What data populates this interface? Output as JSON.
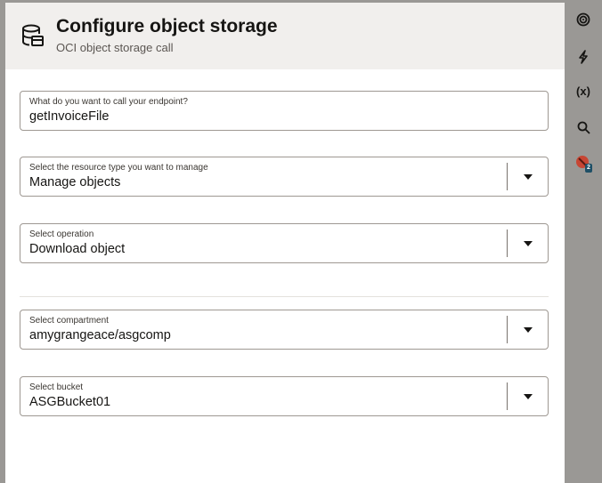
{
  "header": {
    "title": "Configure object storage",
    "subtitle": "OCI object storage call",
    "icon": "database-storage-icon"
  },
  "form": {
    "endpoint": {
      "label": "What do you want to call your endpoint?",
      "value": "getInvoiceFile"
    },
    "resource_type": {
      "label": "Select the resource type you want to manage",
      "value": "Manage objects"
    },
    "operation": {
      "label": "Select operation",
      "value": "Download object"
    },
    "compartment": {
      "label": "Select compartment",
      "value": "amygrangeace/asgcomp"
    },
    "bucket": {
      "label": "Select bucket",
      "value": "ASGBucket01"
    }
  },
  "rail": {
    "items": [
      {
        "icon": "target-icon"
      },
      {
        "icon": "lightning-icon"
      },
      {
        "icon": "variable-icon",
        "text": "(x)"
      },
      {
        "icon": "search-icon"
      },
      {
        "icon": "error-icon",
        "badge": "2"
      }
    ]
  },
  "colors": {
    "background": "#9a9895",
    "header": "#f1efed",
    "badge": "#1e4f66",
    "error": "#c74634"
  }
}
